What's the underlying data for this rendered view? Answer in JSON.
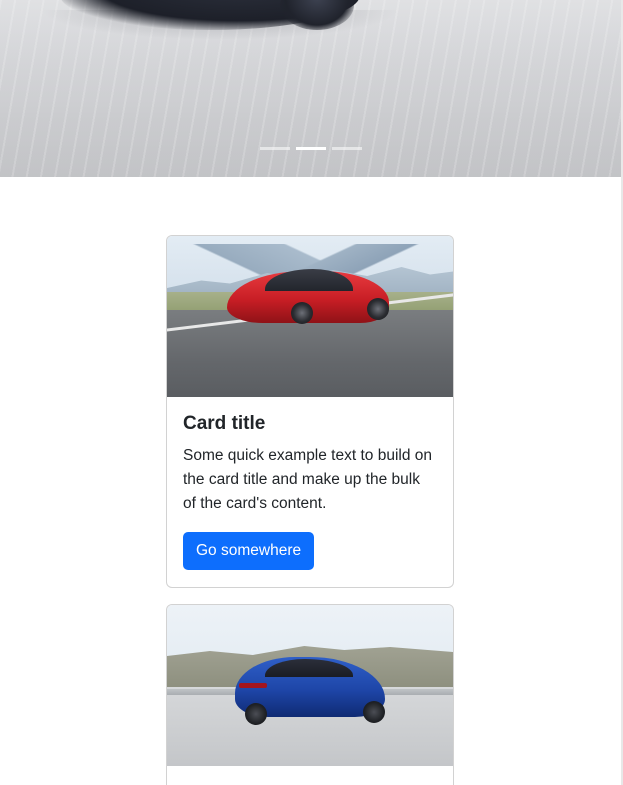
{
  "carousel": {
    "slide_count": 3,
    "active_slide": 2
  },
  "cards": [
    {
      "image": "red-sedan-on-road",
      "title": "Card title",
      "text": "Some quick example text to build on the card title and make up the bulk of the card's content.",
      "button_label": "Go somewhere"
    },
    {
      "image": "blue-suv-on-road"
    }
  ],
  "colors": {
    "primary": "#0d6efd",
    "text": "#212529",
    "border": "#dee2e6"
  }
}
